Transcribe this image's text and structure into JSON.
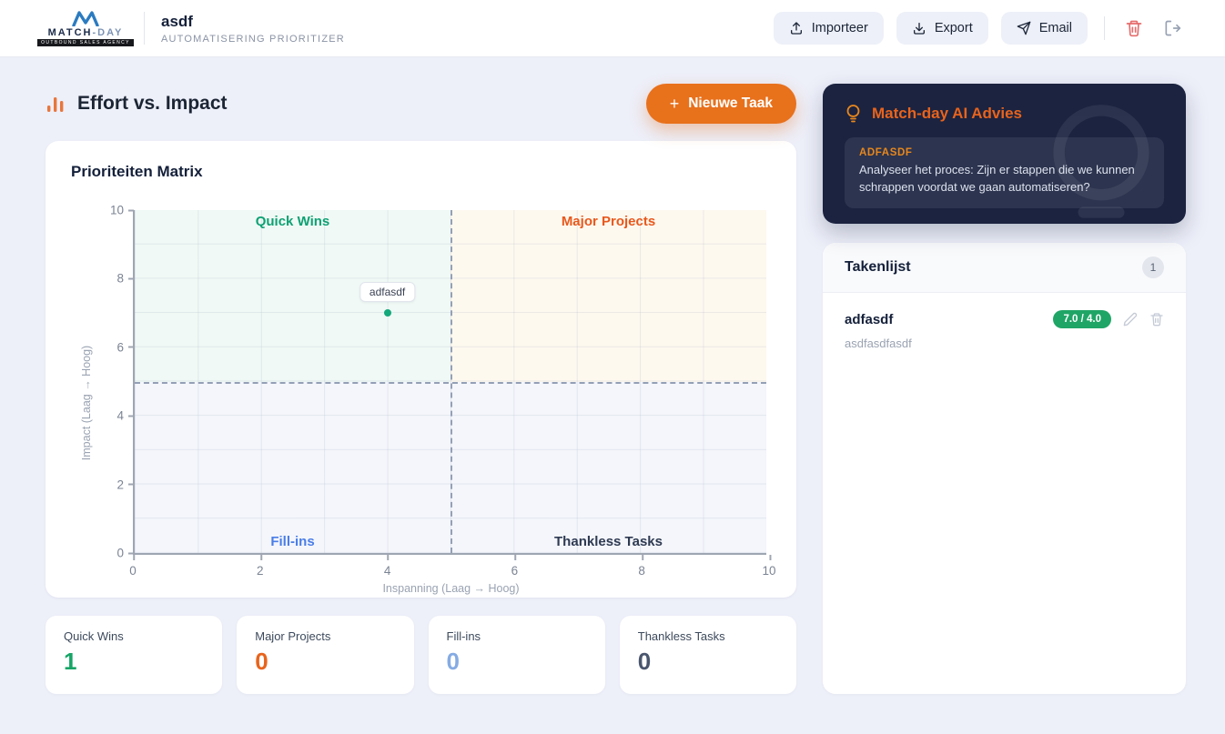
{
  "header": {
    "logo": {
      "brand_a": "MATCH",
      "brand_b": "-DAY",
      "tagline": "OUTBOUND SALES AGENCY"
    },
    "title": "asdf",
    "subtitle": "AUTOMATISERING PRIORITIZER",
    "import_label": "Importeer",
    "export_label": "Export",
    "email_label": "Email"
  },
  "page": {
    "title": "Effort vs. Impact",
    "new_task_plus": "+",
    "new_task_label": "Nieuwe Taak"
  },
  "chart_data": {
    "type": "scatter",
    "title": "Prioriteiten Matrix",
    "xlabel": "Inspanning (Laag → Hoog)",
    "ylabel": "Impact (Laag → Hoog)",
    "xlim": [
      0,
      10
    ],
    "ylim": [
      0,
      10
    ],
    "x_ticks": [
      0,
      2,
      4,
      6,
      8,
      10
    ],
    "y_ticks": [
      0,
      2,
      4,
      6,
      8,
      10
    ],
    "grid": "on",
    "dividers": {
      "x": 5,
      "y": 5,
      "style": "dashed"
    },
    "quadrant_labels": [
      {
        "label": "Quick Wins",
        "position": "top-left",
        "color": "#0EA173"
      },
      {
        "label": "Major Projects",
        "position": "top-right",
        "color": "#E8581C"
      },
      {
        "label": "Fill-ins",
        "position": "bottom-left",
        "color": "#4A7DE8"
      },
      {
        "label": "Thankless Tasks",
        "position": "bottom-right",
        "color": "#2E3A52"
      }
    ],
    "points": [
      {
        "label": "adfasdf",
        "x": 4,
        "y": 7,
        "color": "#14A87B"
      }
    ]
  },
  "stats": [
    {
      "label": "Quick Wins",
      "value": "1",
      "color": "#17A567"
    },
    {
      "label": "Major Projects",
      "value": "0",
      "color": "#E8641C"
    },
    {
      "label": "Fill-ins",
      "value": "0",
      "color": "#85ABE3"
    },
    {
      "label": "Thankless Tasks",
      "value": "0",
      "color": "#4A566E"
    }
  ],
  "ai_card": {
    "title": "Match-day AI Advies",
    "item_title": "ADFASDF",
    "item_text": "Analyseer het proces: Zijn er stappen die we kunnen schrappen voordat we gaan automatiseren?"
  },
  "task_list": {
    "title": "Takenlijst",
    "count": "1",
    "tasks": [
      {
        "name": "adfasdf",
        "description": "asdfasdfasdf",
        "score": "7.0 / 4.0"
      }
    ]
  }
}
